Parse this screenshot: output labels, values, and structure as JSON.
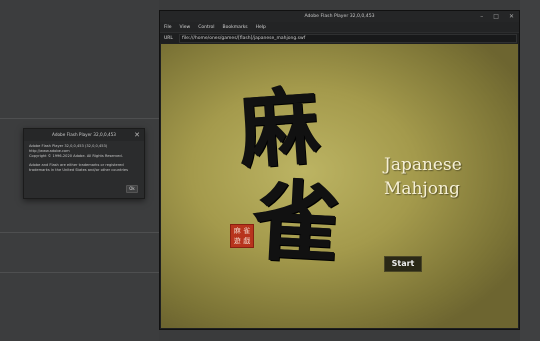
{
  "about_dialog": {
    "title": "Adobe Flash Player 32,0,0,453",
    "close_glyph": "✕",
    "lines": [
      "Adobe Flash Player 32,0,0,453 (32,0,0,453)",
      "http://www.adobe.com",
      "Copyright © 1996-2020 Adobe. All Rights Reserved."
    ],
    "notice_lines": [
      "Adobe and Flash are either trademarks or registered",
      "trademarks in the United States and/or other countries"
    ],
    "ok_label": "Ok"
  },
  "player_window": {
    "title": "Adobe Flash Player 32,0,0,453",
    "window_controls": {
      "minimize": "–",
      "maximize": "□",
      "close": "✕"
    },
    "menu": [
      "File",
      "View",
      "Control",
      "Bookmarks",
      "Help"
    ],
    "url_label": "URL",
    "url_value": "file:///home/ones/games/[flash]/japanese_mahjong.swf"
  },
  "game": {
    "kanji_top": "麻",
    "kanji_bottom": "雀",
    "seal_chars": [
      "麻",
      "雀",
      "遊",
      "戯"
    ],
    "title_line1": "Japanese",
    "title_line2": "Mahjong",
    "start_label": "Start"
  },
  "colors": {
    "stage_center": "#bcb463",
    "stage_edge": "#6d6530",
    "seal_red": "#b8341d",
    "title_text": "#f6f0d6"
  }
}
